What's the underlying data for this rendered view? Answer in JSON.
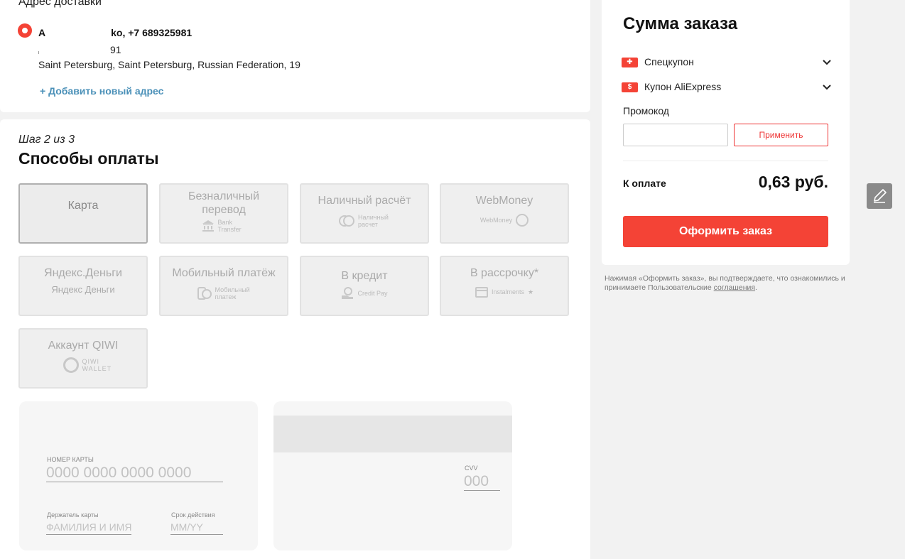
{
  "delivery": {
    "heading": "Адрес доставки",
    "name_start": "A",
    "name_end": "ko, +7 689325981",
    "line2": "91",
    "line3": "Saint Petersburg, Saint Petersburg, Russian Federation, 19",
    "add_address": "+ Добавить новый адрес"
  },
  "payment": {
    "step": "Шаг 2 из 3",
    "title": "Способы оплаты",
    "methods": [
      {
        "label": "Карта",
        "logo": ""
      },
      {
        "label": "Безналичный перевод",
        "logo": "Bank Transfer"
      },
      {
        "label": "Наличный расчёт",
        "logo": "Наличный расчет"
      },
      {
        "label": "WebMoney",
        "logo": "WebMoney"
      },
      {
        "label": "Яндекс.Деньги",
        "logo": "Яндекс Деньги"
      },
      {
        "label": "Мобильный платёж",
        "logo": "Мобильный платеж"
      },
      {
        "label": "В кредит",
        "logo": "Credit Pay"
      },
      {
        "label": "В рассрочку*",
        "logo": "Instalments"
      },
      {
        "label": "Аккаунт QIWI",
        "logo": "QIWI WALLET"
      }
    ],
    "selected_index": 0,
    "card": {
      "number_label": "НОМЕР КАРТЫ",
      "number_placeholder": "0000 0000 0000 0000",
      "holder_label": "Держатель карты",
      "holder_placeholder": "ФАМИЛИЯ И ИМЯ",
      "expiry_label": "Срок действия",
      "expiry_placeholder": "MM/YY",
      "cvv_label": "CVV",
      "cvv_placeholder": "000"
    }
  },
  "summary": {
    "title": "Сумма заказа",
    "special_coupon": "Спецкупон",
    "aliexpress_coupon": "Купон AliExpress",
    "promo_label": "Промокод",
    "apply_label": "Применить",
    "pay_label": "К оплате",
    "amount": "0,63 руб.",
    "order_button": "Оформить заказ"
  },
  "legal": {
    "text": "Нажимая «Оформить заказ», вы подтверждаете, что ознакомились и принимаете Пользовательские ",
    "link": "соглашения",
    "end": "."
  },
  "colors": {
    "accent": "#f44336",
    "link": "#4a90b8",
    "panel": "#ffffff",
    "background": "#f2f2f2"
  }
}
